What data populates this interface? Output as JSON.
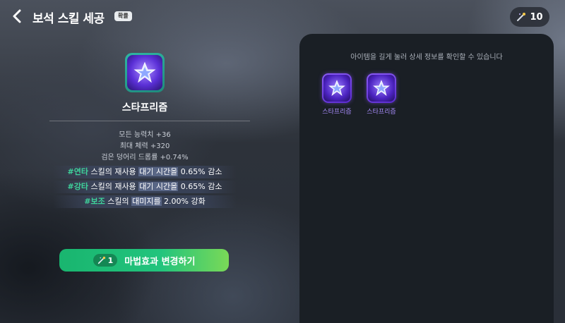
{
  "header": {
    "title": "보석 스킬 세공",
    "badge": "확률"
  },
  "currency": {
    "icon": "wand-icon",
    "count": "10"
  },
  "skill": {
    "icon": "star-prism-icon",
    "name": "스타프리즘",
    "stats": [
      "모든 능력치 +36",
      "최대 체력 +320",
      "검은 덩어리 드롭률 +0.74%"
    ],
    "bonuses": [
      {
        "tag": "#연타",
        "pre": " 스킬의 재사용 ",
        "hl": "대기 시간을",
        "post": " 0.65% 감소"
      },
      {
        "tag": "#강타",
        "pre": " 스킬의 재사용 ",
        "hl": "대기 시간을",
        "post": " 0.65% 감소"
      },
      {
        "tag": "#보조",
        "pre": " 스킬의 ",
        "hl": "대미지를",
        "post": " 2.00% 강화"
      }
    ]
  },
  "change_button": {
    "cost_icon": "wand-icon",
    "cost": "1",
    "label": "마법효과 변경하기"
  },
  "inventory": {
    "hint": "아이템을 길게 눌러 상세 정보를 확인할 수 있습니다",
    "items": [
      {
        "name": "스타프리즘",
        "icon": "star-prism-icon"
      },
      {
        "name": "스타프리즘",
        "icon": "star-prism-icon"
      }
    ]
  },
  "colors": {
    "accent_green": "#22c47d",
    "tag_green": "#3fd39b",
    "item_purple": "#8b5cf6",
    "panel_dark": "#1a1f25"
  }
}
